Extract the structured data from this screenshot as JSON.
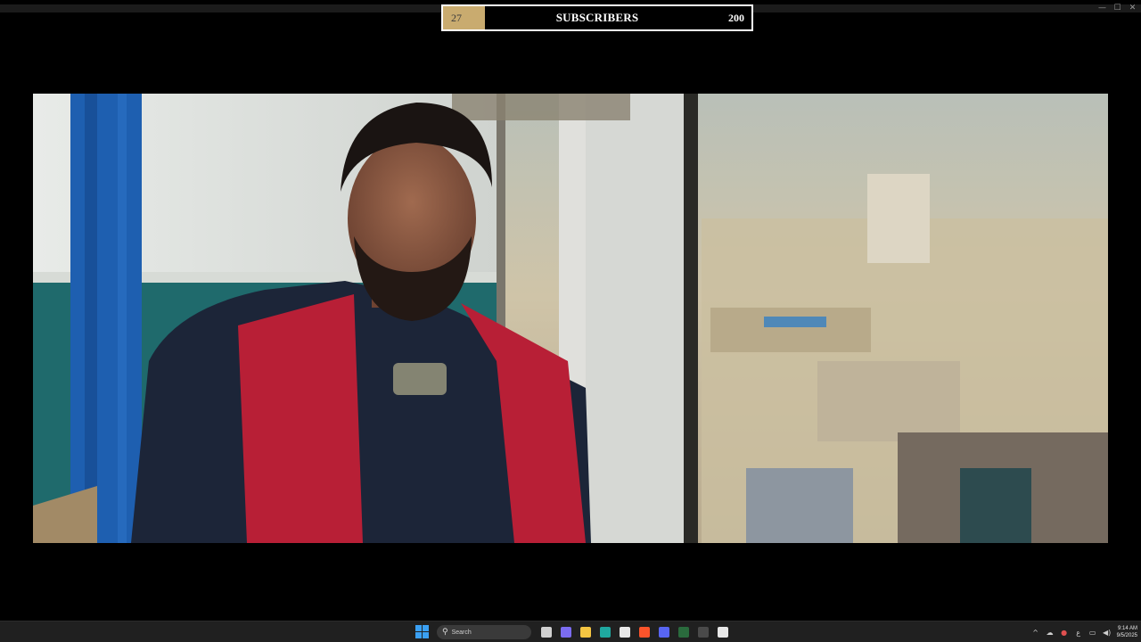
{
  "window": {
    "controls": {
      "minimize": "—",
      "maximize": "☐",
      "close": "✕"
    }
  },
  "goal_overlay": {
    "current": "27",
    "label": "SUBSCRIBERS",
    "target": "200",
    "progress_fraction": 0.135,
    "fill_color": "#c9ab6f"
  },
  "video": {
    "content": "video frame"
  },
  "taskbar": {
    "search_placeholder": "Search",
    "apps": [
      {
        "name": "task-view-icon",
        "color": "#d0d0d0"
      },
      {
        "name": "copilot-icon",
        "color": "#7b6cf0"
      },
      {
        "name": "file-explorer-icon",
        "color": "#f4c542"
      },
      {
        "name": "edge-icon",
        "color": "#1fa8a0"
      },
      {
        "name": "store-icon",
        "color": "#e8e8e8"
      },
      {
        "name": "brave-icon",
        "color": "#fb542b"
      },
      {
        "name": "discord-icon",
        "color": "#5865f2"
      },
      {
        "name": "excel-icon",
        "color": "#2a6b3d"
      },
      {
        "name": "capture-icon",
        "color": "#4a4a4a"
      },
      {
        "name": "streaming-app-icon",
        "color": "#e8e8e8"
      }
    ],
    "tray": {
      "chevron": "^",
      "lang": "ع",
      "time": "9:14 AM",
      "date": "9/5/2025"
    }
  }
}
